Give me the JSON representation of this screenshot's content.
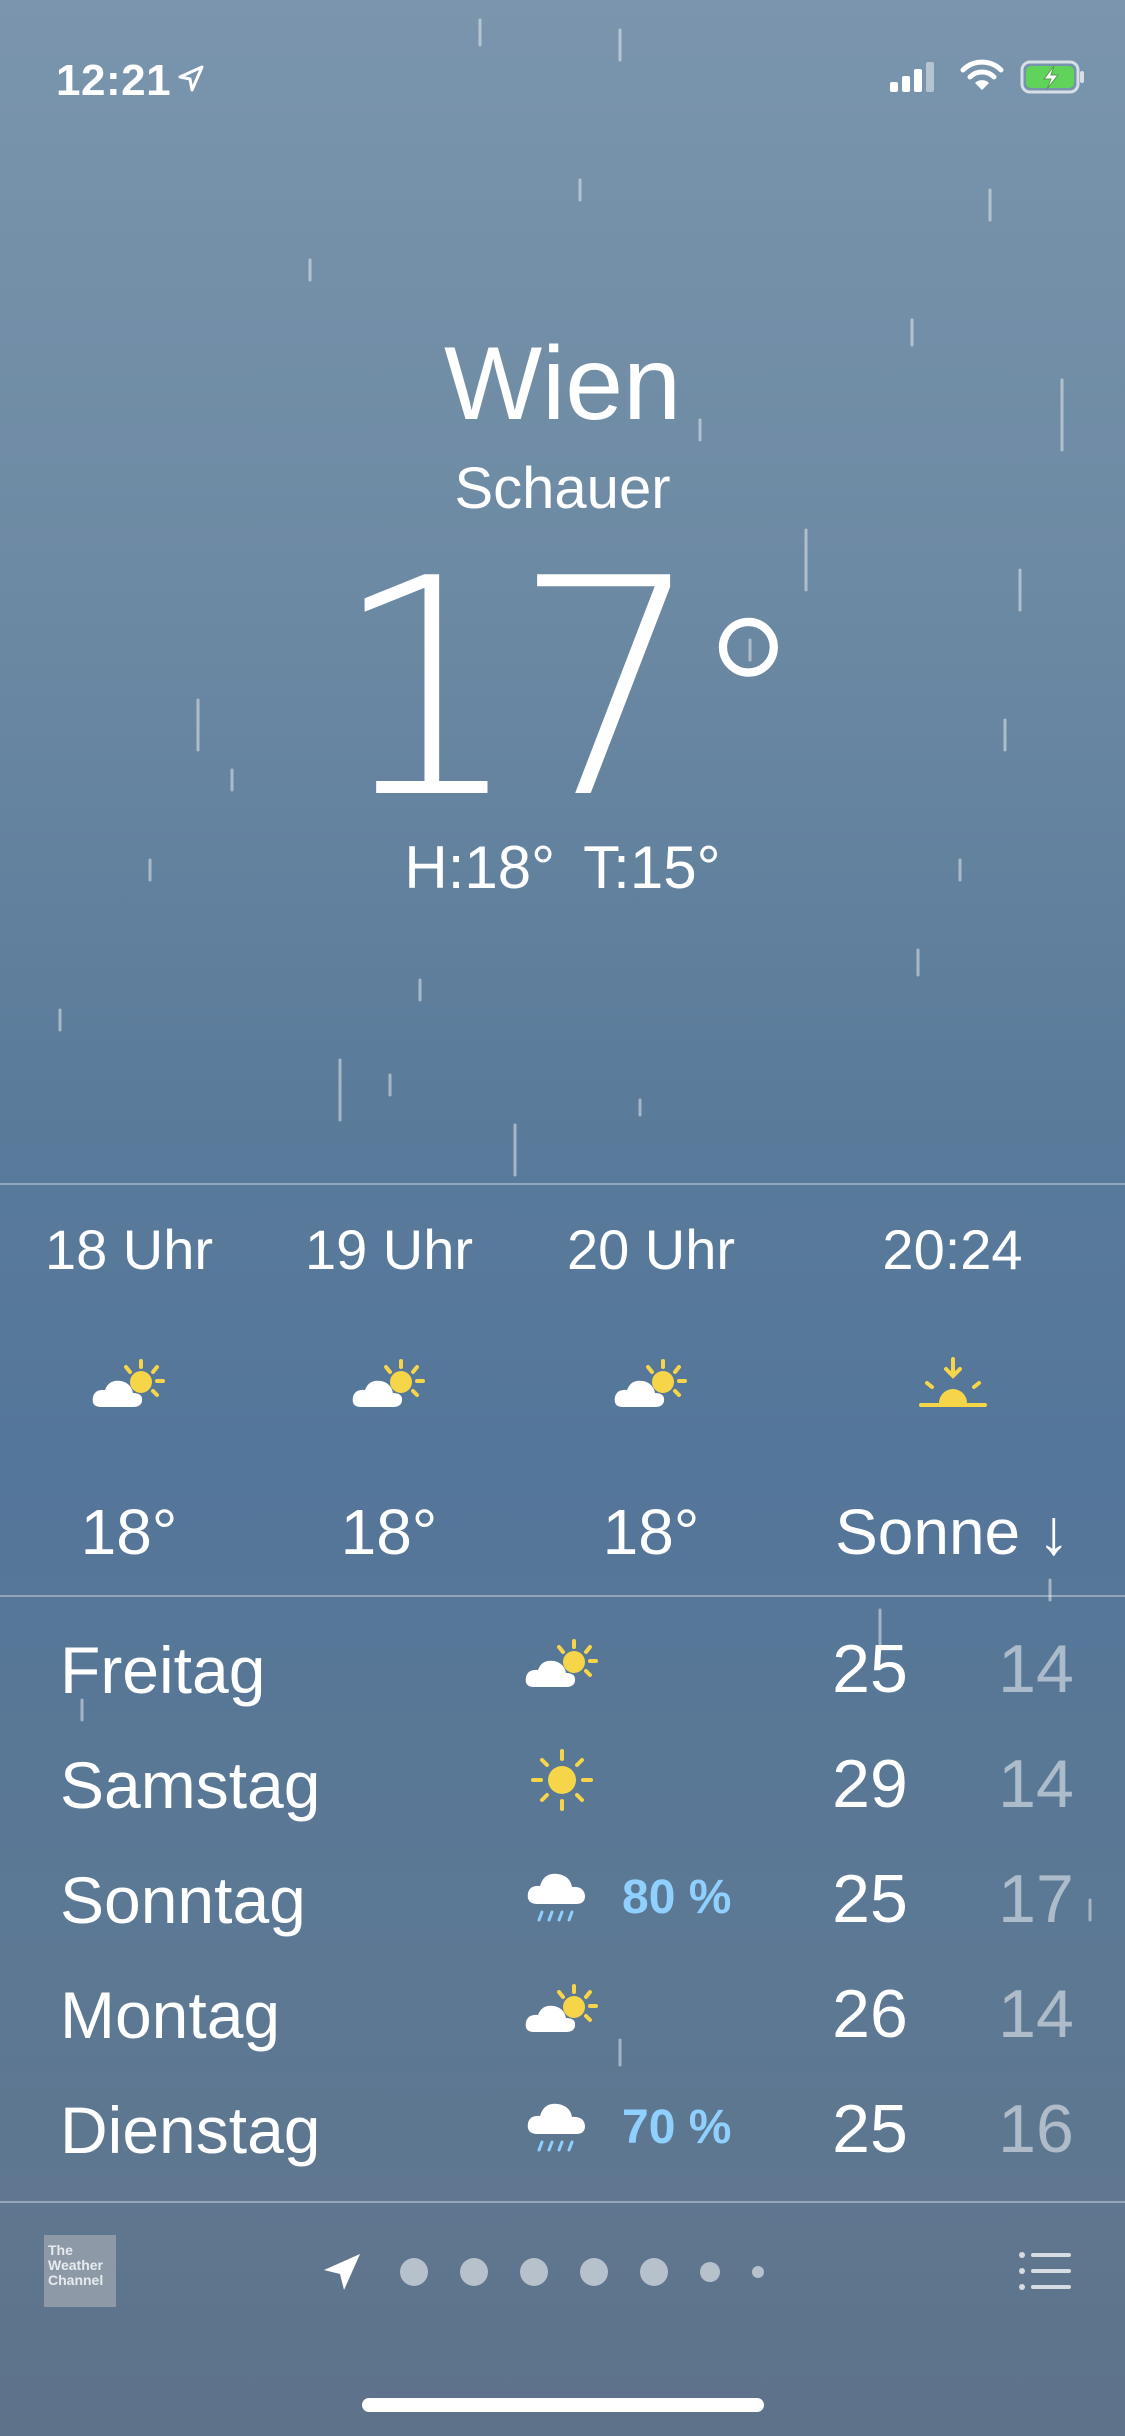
{
  "status_bar": {
    "time": "12:21"
  },
  "current": {
    "city": "Wien",
    "condition": "Schauer",
    "temperature": "17",
    "degree_symbol": "°",
    "high": "H:18°",
    "low": "T:15°"
  },
  "hourly": [
    {
      "label": "18 Uhr",
      "icon": "partly-sunny-icon",
      "value": "18°"
    },
    {
      "label": "19 Uhr",
      "icon": "partly-sunny-icon",
      "value": "18°"
    },
    {
      "label": "20 Uhr",
      "icon": "partly-sunny-icon",
      "value": "18°"
    },
    {
      "label": "20:24",
      "icon": "sunset-icon",
      "value": "Sonne ↓"
    }
  ],
  "daily": [
    {
      "day": "Freitag",
      "icon": "partly-sunny-icon",
      "precip": "",
      "high": "25",
      "low": "14"
    },
    {
      "day": "Samstag",
      "icon": "sun-icon",
      "precip": "",
      "high": "29",
      "low": "14"
    },
    {
      "day": "Sonntag",
      "icon": "rain-cloud-icon",
      "precip": "80 %",
      "high": "25",
      "low": "17"
    },
    {
      "day": "Montag",
      "icon": "partly-sunny-icon",
      "precip": "",
      "high": "26",
      "low": "14"
    },
    {
      "day": "Dienstag",
      "icon": "rain-cloud-icon",
      "precip": "70 %",
      "high": "25",
      "low": "16"
    }
  ],
  "footer": {
    "provider_logo": "The Weather Channel"
  },
  "colors": {
    "sun": "#f7d548",
    "precip": "#8fd0ff"
  }
}
